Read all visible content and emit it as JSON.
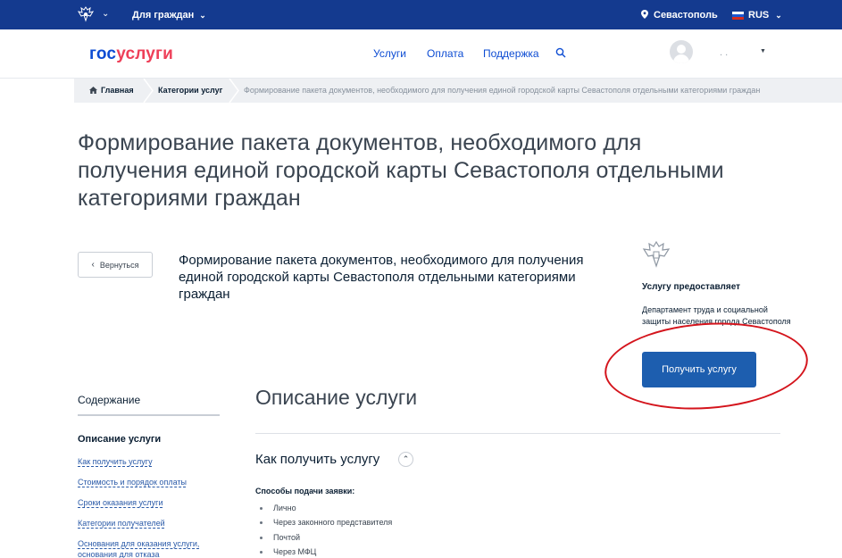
{
  "topbar": {
    "for_citizens": "Для граждан",
    "city": "Севастополь",
    "language": "RUS"
  },
  "header": {
    "logo_gos": "гос",
    "logo_uslugi": "услуги",
    "nav": {
      "services": "Услуги",
      "payment": "Оплата",
      "support": "Поддержка"
    },
    "user_name": ". ."
  },
  "breadcrumb": {
    "home": "Главная",
    "categories": "Категории услуг",
    "current": "Формирование пакета документов, необходимого для получения единой городской карты Севастополя отдельными категориями граждан"
  },
  "page": {
    "title": "Формирование пакета документов, необходимого для получения единой городской карты Севастополя отдельными категориями граждан",
    "back_label": "Вернуться",
    "subtitle": "Формирование пакета документов, необходимого для получения единой городской карты Севастополя отдельными категориями граждан"
  },
  "provider": {
    "label": "Услугу предоставляет",
    "name": "Департамент труда и социальной защиты населения города Севастополя",
    "get_service_label": "Получить услугу"
  },
  "toc": {
    "title": "Содержание",
    "active": "Описание услуги",
    "links": [
      "Как получить услугу",
      "Стоимость и порядок оплаты",
      "Сроки оказания услуги",
      "Категории получателей",
      "Основания для оказания услуги, основания для отказа"
    ]
  },
  "main": {
    "section_title": "Описание услуги",
    "how_title": "Как получить услугу",
    "methods_label": "Способы подачи заявки:",
    "methods": [
      "Лично",
      "Через законного представителя",
      "Почтой",
      "Через МФЦ"
    ]
  },
  "colors": {
    "topbar": "#143a8f",
    "link": "#0d4cd3",
    "logo_red": "#ee3f58",
    "button": "#1d5eaf",
    "annotation": "#d4141c"
  }
}
